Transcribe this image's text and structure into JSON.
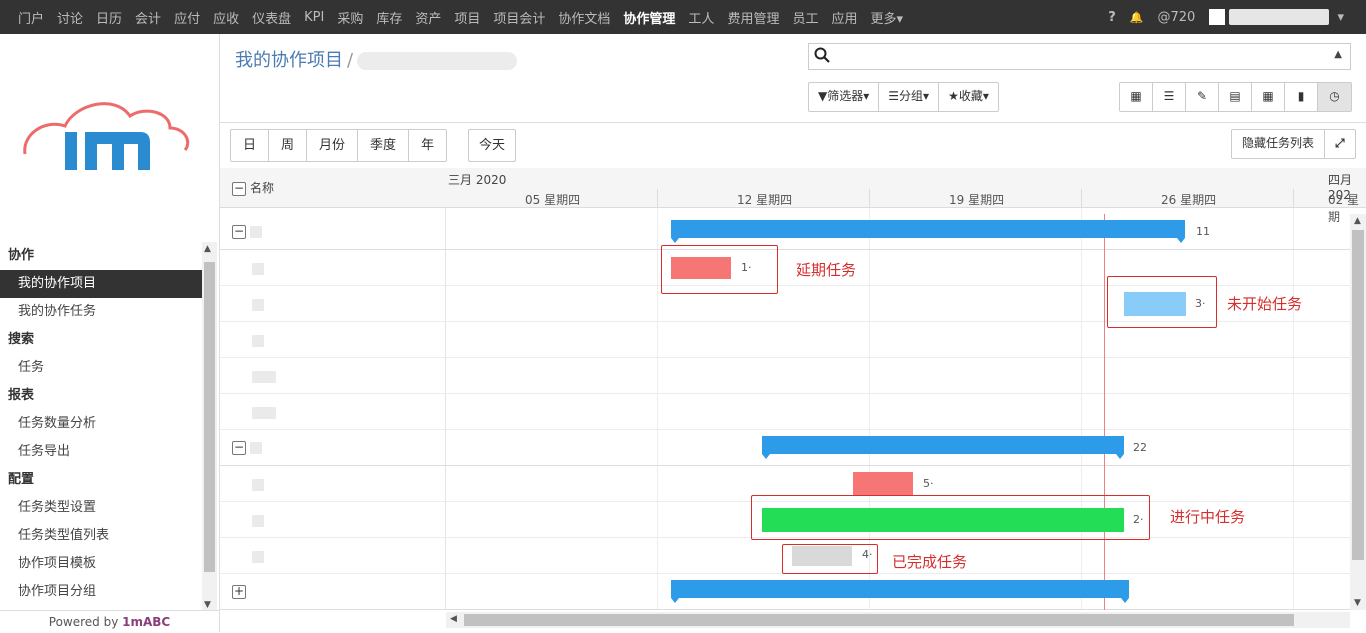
{
  "nav": {
    "items": [
      "门户",
      "讨论",
      "日历",
      "会计",
      "应付",
      "应收",
      "仪表盘",
      "KPI",
      "采购",
      "库存",
      "资产",
      "项目",
      "项目会计",
      "协作文档",
      "协作管理",
      "工人",
      "费用管理",
      "员工",
      "应用",
      "更多▾"
    ],
    "active": "协作管理",
    "help": "?",
    "bell": "🔔",
    "mentions": "@720",
    "user_caret": "▾"
  },
  "sidebar": {
    "sections": [
      {
        "title": "协作",
        "items": [
          "我的协作项目",
          "我的协作任务"
        ]
      },
      {
        "title": "搜索",
        "items": [
          "任务"
        ]
      },
      {
        "title": "报表",
        "items": [
          "任务数量分析",
          "任务导出"
        ]
      },
      {
        "title": "配置",
        "items": [
          "任务类型设置",
          "任务类型值列表",
          "协作项目模板",
          "协作项目分组"
        ]
      }
    ],
    "active_item": "我的协作项目",
    "powered_prefix": "Powered by ",
    "powered_brand": "1mABC"
  },
  "breadcrumb": {
    "root": "我的协作项目",
    "sep": "/"
  },
  "search": {
    "placeholder": ""
  },
  "filters": {
    "filter": "▼筛选器▾",
    "group": "☰分组▾",
    "favorite": "★收藏▾"
  },
  "views": [
    "▦",
    "☰",
    "✎",
    "▤",
    "▦",
    "▮",
    "◷"
  ],
  "scale": {
    "day": "日",
    "week": "周",
    "month": "月份",
    "quarter": "季度",
    "year": "年",
    "today": "今天"
  },
  "hide_tasks": "隐藏任务列表",
  "expand_icon": "⤢",
  "gantt": {
    "name_header": "名称",
    "month1": "三月 2020",
    "month2": "四月 202",
    "weeks": [
      "05 星期四",
      "12 星期四",
      "19 星期四",
      "26 星期四",
      "02 星期"
    ],
    "groups": [
      {
        "label": "11",
        "toggle": "−"
      },
      {
        "label": "22",
        "toggle": "−"
      },
      {
        "toggle": "+"
      }
    ],
    "tasks": [
      "1·",
      "3·",
      "5·",
      "2·",
      "4·"
    ],
    "annotations": {
      "delayed": "延期任务",
      "not_started": "未开始任务",
      "in_progress": "进行中任务",
      "done": "已完成任务"
    }
  },
  "colors": {
    "nav_bg": "#333333",
    "group_bar": "#2d9be8",
    "delayed": "#f67575",
    "not_started": "#89ccf7",
    "in_progress": "#22dd55",
    "done": "#d9d9d9",
    "callout": "#d62d2d",
    "link": "#4a7cb3"
  }
}
